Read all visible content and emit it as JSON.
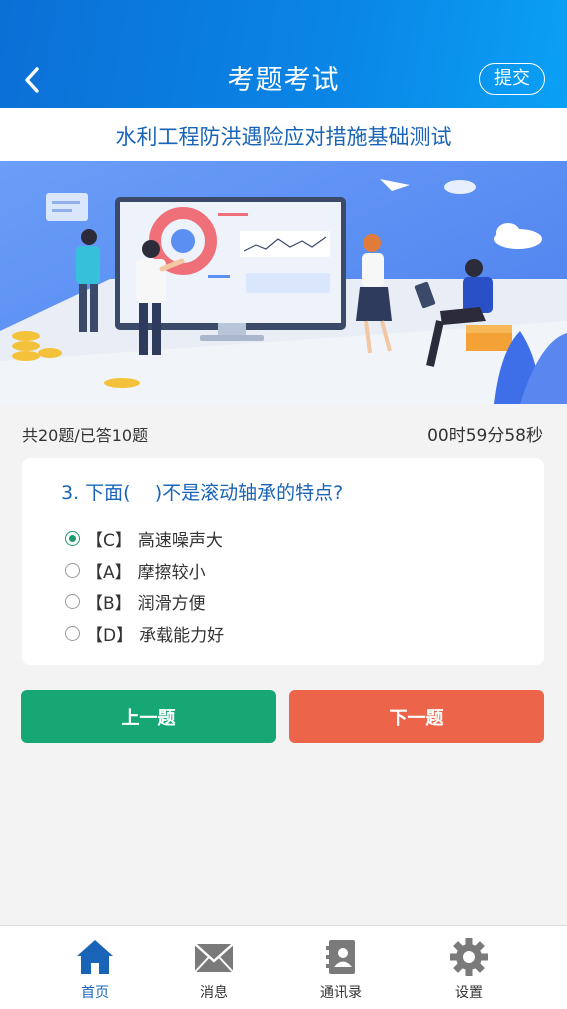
{
  "header": {
    "title": "考题考试",
    "submit_label": "提交"
  },
  "exam": {
    "title": "水利工程防洪遇险应对措施基础测试"
  },
  "progress": {
    "summary": "共20题/已答10题",
    "timer": "00时59分58秒",
    "total_questions": 20,
    "answered": 10
  },
  "question": {
    "text": "3. 下面(    )不是滚动轴承的特点?",
    "options": [
      {
        "key": "【C】",
        "text": "高速噪声大",
        "selected": true
      },
      {
        "key": "【A】",
        "text": "摩擦较小",
        "selected": false
      },
      {
        "key": "【B】",
        "text": "润滑方便",
        "selected": false
      },
      {
        "key": "【D】",
        "text": "承载能力好",
        "selected": false
      }
    ]
  },
  "buttons": {
    "prev_label": "上一题",
    "next_label": "下一题"
  },
  "tabbar": {
    "items": [
      {
        "label": "首页",
        "icon": "home-icon",
        "active": true
      },
      {
        "label": "消息",
        "icon": "mail-icon",
        "active": false
      },
      {
        "label": "通讯录",
        "icon": "contacts-icon",
        "active": false
      },
      {
        "label": "设置",
        "icon": "gear-icon",
        "active": false
      }
    ]
  },
  "colors": {
    "primary_blue": "#1a64b8",
    "header_gradient_start": "#0b6fd6",
    "header_gradient_end": "#0aa0f5",
    "prev_button": "#16a775",
    "next_button": "#ec654a",
    "selected_radio": "#1e9a6a",
    "background": "#f3f3f3"
  }
}
